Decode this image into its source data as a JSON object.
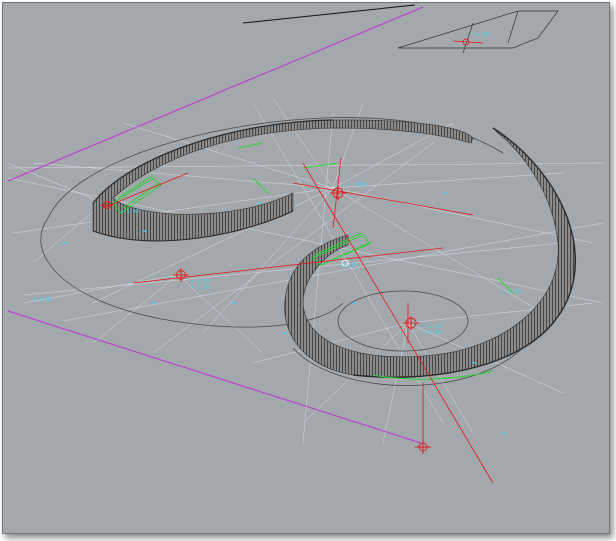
{
  "viewport": {
    "background": "#a3a8ad",
    "colors": {
      "boundary": "#c233d6",
      "axis": "#e01818",
      "construction": "#e8eef4",
      "surface": "#6f6f6f",
      "surface_edge": "#2f2f2f",
      "accent": "#2fd13a",
      "annotation": "#33d6f0",
      "outline": "#4a4a4a"
    },
    "icons": [
      "cad-origin-marker-icon"
    ]
  }
}
